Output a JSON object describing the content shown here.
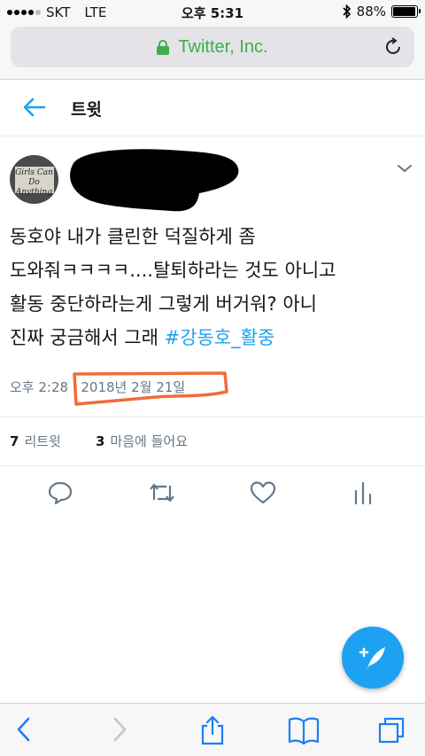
{
  "status_bar": {
    "carrier": "SKT",
    "network": "LTE",
    "time": "오후 5:31",
    "battery_percent": "88%",
    "battery_level": 0.88
  },
  "browser": {
    "url_label": "Twitter, Inc."
  },
  "header": {
    "title": "트윗"
  },
  "tweet": {
    "avatar_text": "Girls Can Do Anything",
    "text_lines": [
      "동호야 내가 클린한 덕질하게 좀",
      "도와줘ㅋㅋㅋㅋ....탈퇴하라는 것도 아니고",
      "활동 중단하라는게 그렇게 버거워? 아니"
    ],
    "text_last_prefix": "진짜 궁금해서 그래 ",
    "hashtag": "#강동호_활중",
    "time": "오후 2:28",
    "separator": " · ",
    "date": "2018년 2월 21일",
    "retweet_count": "7",
    "retweet_label": "리트윗",
    "like_count": "3",
    "like_label": "마음에 들어요"
  },
  "colors": {
    "accent": "#1da1f2",
    "secure": "#3fae48",
    "annotation": "#f26b3a",
    "muted": "#657786",
    "redaction": "#000000"
  },
  "icons": {
    "back": "arrow-left-icon",
    "reload": "reload-icon",
    "caret": "chevron-down-icon",
    "reply": "reply-icon",
    "retweet": "retweet-icon",
    "like": "heart-icon",
    "analytics": "analytics-icon",
    "compose": "compose-tweet-icon",
    "nav_back": "chevron-left-icon",
    "nav_forward": "chevron-right-icon",
    "share": "share-icon",
    "bookmarks": "book-icon",
    "tabs": "tabs-icon"
  }
}
